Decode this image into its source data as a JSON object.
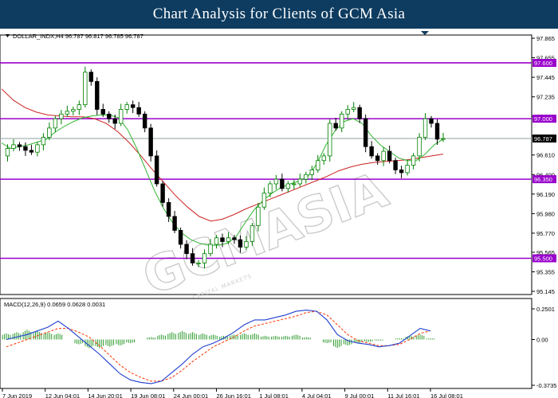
{
  "banner": {
    "title": "Chart Analysis for Clients of GCM Asia"
  },
  "instrument_line": "DOLLAR_INDX,H4  96.787 96.817 96.785 96.787",
  "macd_label": "MACD(12,26,9) 0.0659 0.0628 0.0031",
  "watermark": {
    "brand": "GCMASIA",
    "tagline": "GLOBAL CAPITAL MARKETS"
  },
  "colors": {
    "up_candle": "#008000",
    "down_candle": "#000000",
    "level_line": "#9900cc",
    "ma_fast": "#2fb52f",
    "ma_slow": "#cc2222",
    "macd_line": "#1f3fcf",
    "signal_line": "#ff3300",
    "histogram": "#2e9b2e",
    "price_tag": "#000000",
    "level_tag": "#9900cc"
  },
  "chart_data": [
    {
      "type": "line",
      "title": "DOLLAR_INDX,H4",
      "ylim": [
        95.145,
        97.865
      ],
      "y_ticks": [
        "97.865",
        "97.655",
        "97.445",
        "97.235",
        "97.025",
        "96.815",
        "96.610",
        "96.400",
        "96.190",
        "95.980",
        "95.770",
        "95.565",
        "95.355",
        "95.145"
      ],
      "x_ticks": [
        "7 Jun 2019",
        "12 Jun 04:01",
        "14 Jun 20:01",
        "19 Jun 08:01",
        "24 Jun 00:01",
        "26 Jun 16:01",
        "1 Jul 08:01",
        "4 Jul 04:01",
        "9 Jul 00:01",
        "11 Jul 16:01",
        "16 Jul 08:01"
      ],
      "levels": [
        {
          "value": 97.6,
          "label": "97.600"
        },
        {
          "value": 97.0,
          "label": "97.000"
        },
        {
          "value": 96.35,
          "label": "96.350"
        },
        {
          "value": 95.5,
          "label": "95.500"
        }
      ],
      "current_price": {
        "value": 96.787,
        "label": "96.787"
      },
      "series": [
        {
          "key": "close",
          "values": [
            96.6,
            96.68,
            96.72,
            96.7,
            96.66,
            96.64,
            96.72,
            96.8,
            96.9,
            97.0,
            97.05,
            97.08,
            97.1,
            97.15,
            97.5,
            97.4,
            97.1,
            97.05,
            97.0,
            96.95,
            97.1,
            97.15,
            97.12,
            97.05,
            96.9,
            96.6,
            96.3,
            96.1,
            95.95,
            95.8,
            95.65,
            95.55,
            95.45,
            95.45,
            95.55,
            95.65,
            95.72,
            95.68,
            95.72,
            95.7,
            95.62,
            95.68,
            95.85,
            96.05,
            96.2,
            96.3,
            96.35,
            96.25,
            96.3,
            96.3,
            96.35,
            96.4,
            96.45,
            96.55,
            96.6,
            96.95,
            96.9,
            97.05,
            97.1,
            97.12,
            97.0,
            96.7,
            96.6,
            96.55,
            96.65,
            96.55,
            96.45,
            96.42,
            96.5,
            96.6,
            96.8,
            97.0,
            96.95,
            96.78,
            96.787
          ]
        },
        {
          "key": "ma_fast",
          "values": [
            96.74,
            96.68,
            96.7,
            96.72,
            96.75,
            96.78,
            96.86,
            96.92,
            96.97,
            97.01,
            97.03,
            97.04,
            97.04,
            97.01,
            96.88,
            96.68,
            96.45,
            96.22,
            96.03,
            95.88,
            95.77,
            95.7,
            95.66,
            95.64,
            95.64,
            95.66,
            95.73,
            95.88,
            96.02,
            96.12,
            96.2,
            96.26,
            96.3,
            96.33,
            96.38,
            96.52,
            96.72,
            96.87,
            96.97,
            97.0,
            96.95,
            96.82,
            96.72,
            96.65,
            96.58,
            96.55,
            96.55,
            96.62,
            96.72,
            96.78
          ]
        },
        {
          "key": "ma_slow",
          "values": [
            97.32,
            97.2,
            97.12,
            97.07,
            97.04,
            97.03,
            97.02,
            97.02,
            97.0,
            96.95,
            96.86,
            96.74,
            96.6,
            96.45,
            96.31,
            96.17,
            96.05,
            95.95,
            95.9,
            95.92,
            95.97,
            96.03,
            96.08,
            96.13,
            96.18,
            96.23,
            96.28,
            96.33,
            96.38,
            96.44,
            96.48,
            96.51,
            96.53,
            96.54,
            96.55,
            96.56,
            96.58,
            96.6,
            96.62
          ]
        },
        {
          "key": "macd_line",
          "ylim": [
            -0.3735,
            0.2501
          ],
          "values": [
            0.0,
            0.02,
            0.04,
            0.07,
            0.1,
            0.15,
            0.09,
            0.02,
            -0.05,
            -0.12,
            -0.2,
            -0.28,
            -0.33,
            -0.35,
            -0.36,
            -0.34,
            -0.27,
            -0.2,
            -0.12,
            -0.06,
            -0.03,
            0.01,
            0.06,
            0.12,
            0.16,
            0.16,
            0.18,
            0.2,
            0.23,
            0.24,
            0.23,
            0.16,
            0.04,
            -0.01,
            -0.03,
            -0.04,
            -0.06,
            -0.05,
            -0.03,
            0.03,
            0.09,
            0.07
          ]
        },
        {
          "key": "signal_line",
          "values": [
            -0.06,
            -0.03,
            0.0,
            0.03,
            0.06,
            0.09,
            0.09,
            0.06,
            0.02,
            -0.05,
            -0.13,
            -0.21,
            -0.27,
            -0.31,
            -0.34,
            -0.34,
            -0.31,
            -0.25,
            -0.18,
            -0.12,
            -0.06,
            -0.02,
            0.02,
            0.07,
            0.11,
            0.13,
            0.15,
            0.17,
            0.19,
            0.22,
            0.23,
            0.2,
            0.12,
            0.04,
            -0.01,
            -0.03,
            -0.05,
            -0.05,
            -0.04,
            0.0,
            0.05,
            0.07
          ]
        },
        {
          "key": "histogram",
          "values": [
            0.05,
            0.06,
            0.08,
            0.07,
            0.06,
            0.05,
            0.0,
            -0.04,
            -0.07,
            -0.07,
            -0.06,
            -0.05,
            -0.03,
            0.0,
            0.02,
            0.04,
            0.06,
            0.07,
            0.06,
            0.05,
            0.04,
            0.03,
            0.04,
            0.05,
            0.05,
            0.03,
            0.03,
            0.03,
            0.04,
            0.02,
            0.0,
            -0.03,
            -0.07,
            -0.05,
            -0.03,
            -0.02,
            -0.01,
            0.0,
            0.01,
            0.03,
            0.04,
            0.01
          ]
        }
      ]
    }
  ]
}
